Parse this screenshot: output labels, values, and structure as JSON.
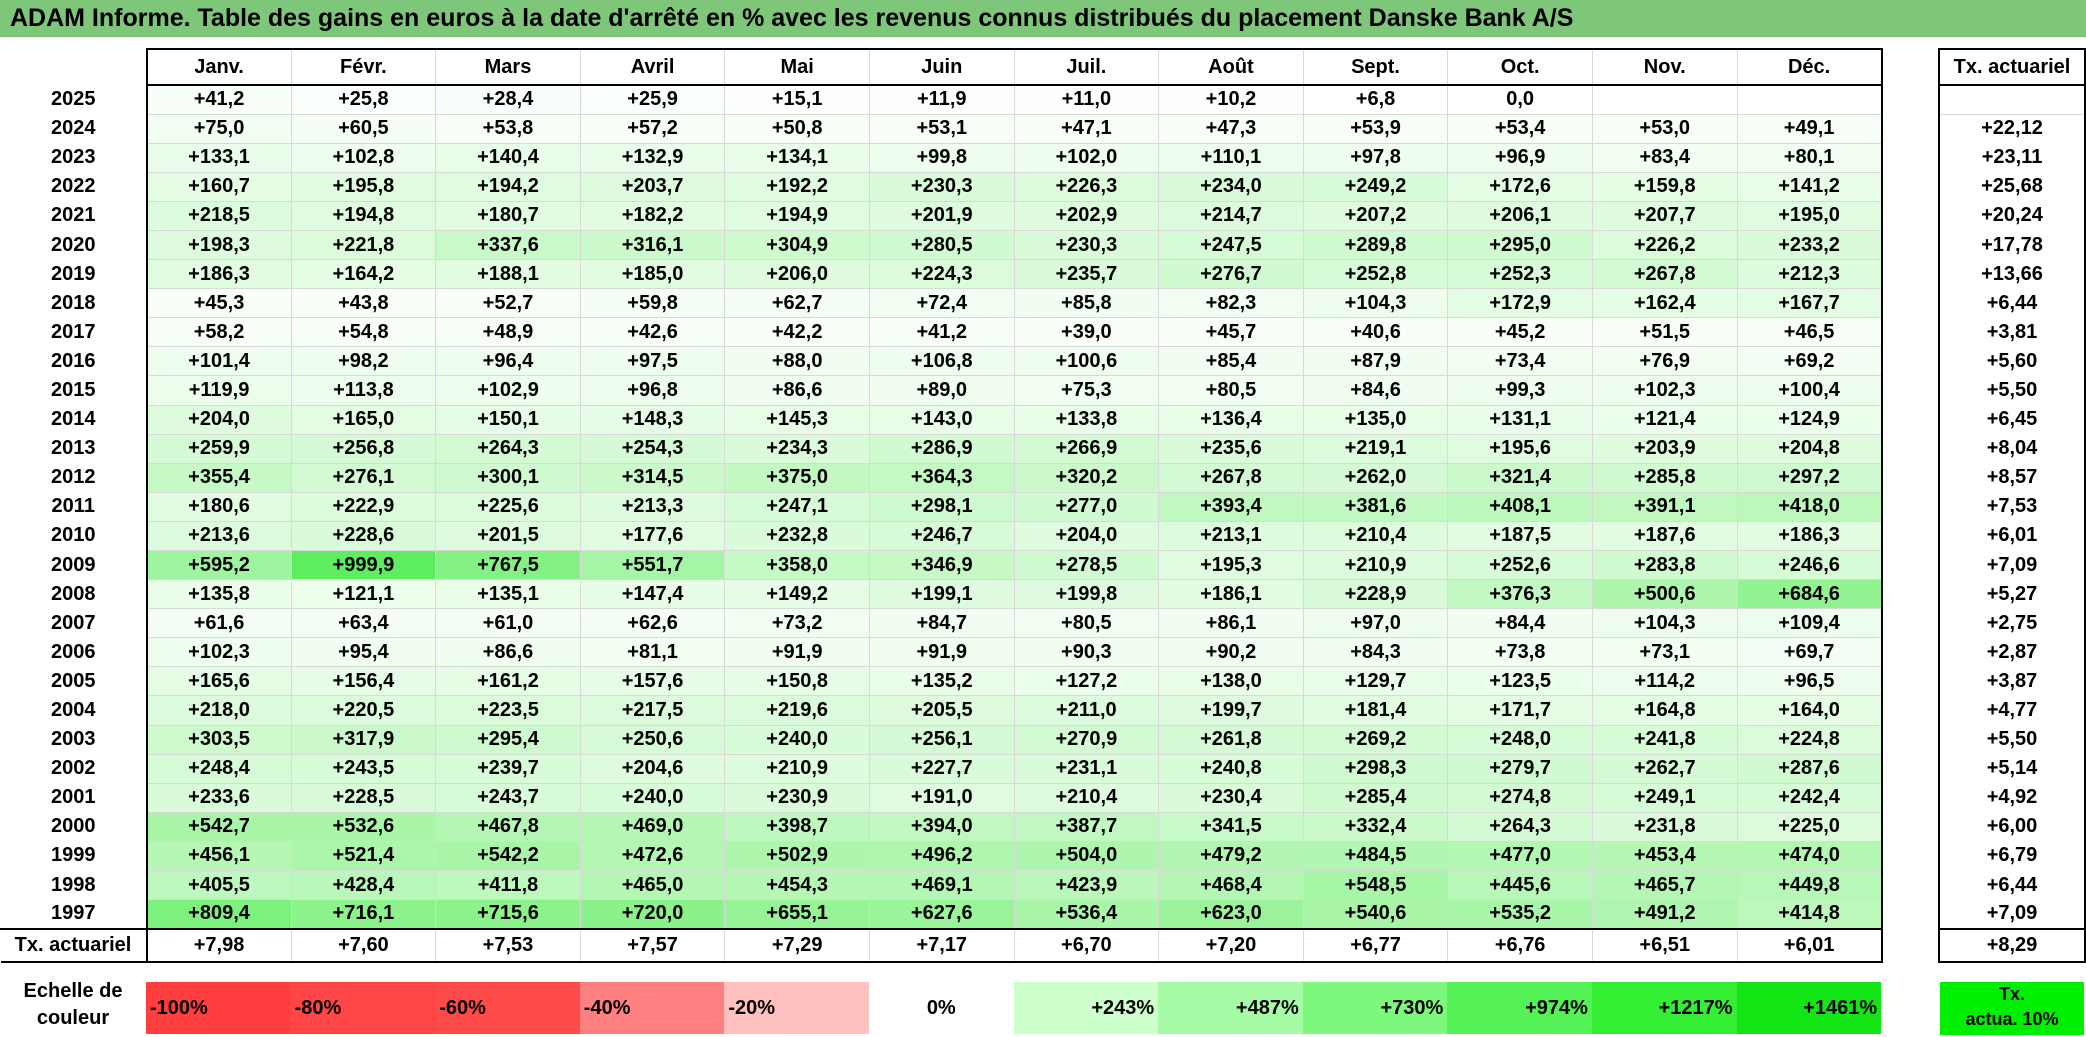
{
  "title": "ADAM Informe. Table des gains en euros à la date d'arrêté en % avec les revenus connus distribués du placement Danske Bank A/S",
  "months": [
    "Janv.",
    "Févr.",
    "Mars",
    "Avril",
    "Mai",
    "Juin",
    "Juil.",
    "Août",
    "Sept.",
    "Oct.",
    "Nov.",
    "Déc."
  ],
  "tx_header": "Tx. actuariel",
  "rows": [
    {
      "year": "2025",
      "values": [
        "+41,2",
        "+25,8",
        "+28,4",
        "+25,9",
        "+15,1",
        "+11,9",
        "+11,0",
        "+10,2",
        "+6,8",
        "0,0",
        "",
        ""
      ],
      "tx": ""
    },
    {
      "year": "2024",
      "values": [
        "+75,0",
        "+60,5",
        "+53,8",
        "+57,2",
        "+50,8",
        "+53,1",
        "+47,1",
        "+47,3",
        "+53,9",
        "+53,4",
        "+53,0",
        "+49,1"
      ],
      "tx": "+22,12"
    },
    {
      "year": "2023",
      "values": [
        "+133,1",
        "+102,8",
        "+140,4",
        "+132,9",
        "+134,1",
        "+99,8",
        "+102,0",
        "+110,1",
        "+97,8",
        "+96,9",
        "+83,4",
        "+80,1"
      ],
      "tx": "+23,11"
    },
    {
      "year": "2022",
      "values": [
        "+160,7",
        "+195,8",
        "+194,2",
        "+203,7",
        "+192,2",
        "+230,3",
        "+226,3",
        "+234,0",
        "+249,2",
        "+172,6",
        "+159,8",
        "+141,2"
      ],
      "tx": "+25,68"
    },
    {
      "year": "2021",
      "values": [
        "+218,5",
        "+194,8",
        "+180,7",
        "+182,2",
        "+194,9",
        "+201,9",
        "+202,9",
        "+214,7",
        "+207,2",
        "+206,1",
        "+207,7",
        "+195,0"
      ],
      "tx": "+20,24"
    },
    {
      "year": "2020",
      "values": [
        "+198,3",
        "+221,8",
        "+337,6",
        "+316,1",
        "+304,9",
        "+280,5",
        "+230,3",
        "+247,5",
        "+289,8",
        "+295,0",
        "+226,2",
        "+233,2"
      ],
      "tx": "+17,78"
    },
    {
      "year": "2019",
      "values": [
        "+186,3",
        "+164,2",
        "+188,1",
        "+185,0",
        "+206,0",
        "+224,3",
        "+235,7",
        "+276,7",
        "+252,8",
        "+252,3",
        "+267,8",
        "+212,3"
      ],
      "tx": "+13,66"
    },
    {
      "year": "2018",
      "values": [
        "+45,3",
        "+43,8",
        "+52,7",
        "+59,8",
        "+62,7",
        "+72,4",
        "+85,8",
        "+82,3",
        "+104,3",
        "+172,9",
        "+162,4",
        "+167,7"
      ],
      "tx": "+6,44"
    },
    {
      "year": "2017",
      "values": [
        "+58,2",
        "+54,8",
        "+48,9",
        "+42,6",
        "+42,2",
        "+41,2",
        "+39,0",
        "+45,7",
        "+40,6",
        "+45,2",
        "+51,5",
        "+46,5"
      ],
      "tx": "+3,81"
    },
    {
      "year": "2016",
      "values": [
        "+101,4",
        "+98,2",
        "+96,4",
        "+97,5",
        "+88,0",
        "+106,8",
        "+100,6",
        "+85,4",
        "+87,9",
        "+73,4",
        "+76,9",
        "+69,2"
      ],
      "tx": "+5,60"
    },
    {
      "year": "2015",
      "values": [
        "+119,9",
        "+113,8",
        "+102,9",
        "+96,8",
        "+86,6",
        "+89,0",
        "+75,3",
        "+80,5",
        "+84,6",
        "+99,3",
        "+102,3",
        "+100,4"
      ],
      "tx": "+5,50"
    },
    {
      "year": "2014",
      "values": [
        "+204,0",
        "+165,0",
        "+150,1",
        "+148,3",
        "+145,3",
        "+143,0",
        "+133,8",
        "+136,4",
        "+135,0",
        "+131,1",
        "+121,4",
        "+124,9"
      ],
      "tx": "+6,45"
    },
    {
      "year": "2013",
      "values": [
        "+259,9",
        "+256,8",
        "+264,3",
        "+254,3",
        "+234,3",
        "+286,9",
        "+266,9",
        "+235,6",
        "+219,1",
        "+195,6",
        "+203,9",
        "+204,8"
      ],
      "tx": "+8,04"
    },
    {
      "year": "2012",
      "values": [
        "+355,4",
        "+276,1",
        "+300,1",
        "+314,5",
        "+375,0",
        "+364,3",
        "+320,2",
        "+267,8",
        "+262,0",
        "+321,4",
        "+285,8",
        "+297,2"
      ],
      "tx": "+8,57"
    },
    {
      "year": "2011",
      "values": [
        "+180,6",
        "+222,9",
        "+225,6",
        "+213,3",
        "+247,1",
        "+298,1",
        "+277,0",
        "+393,4",
        "+381,6",
        "+408,1",
        "+391,1",
        "+418,0"
      ],
      "tx": "+7,53"
    },
    {
      "year": "2010",
      "values": [
        "+213,6",
        "+228,6",
        "+201,5",
        "+177,6",
        "+232,8",
        "+246,7",
        "+204,0",
        "+213,1",
        "+210,4",
        "+187,5",
        "+187,6",
        "+186,3"
      ],
      "tx": "+6,01"
    },
    {
      "year": "2009",
      "values": [
        "+595,2",
        "+999,9",
        "+767,5",
        "+551,7",
        "+358,0",
        "+346,9",
        "+278,5",
        "+195,3",
        "+210,9",
        "+252,6",
        "+283,8",
        "+246,6"
      ],
      "tx": "+7,09"
    },
    {
      "year": "2008",
      "values": [
        "+135,8",
        "+121,1",
        "+135,1",
        "+147,4",
        "+149,2",
        "+199,1",
        "+199,8",
        "+186,1",
        "+228,9",
        "+376,3",
        "+500,6",
        "+684,6"
      ],
      "tx": "+5,27"
    },
    {
      "year": "2007",
      "values": [
        "+61,6",
        "+63,4",
        "+61,0",
        "+62,6",
        "+73,2",
        "+84,7",
        "+80,5",
        "+86,1",
        "+97,0",
        "+84,4",
        "+104,3",
        "+109,4"
      ],
      "tx": "+2,75"
    },
    {
      "year": "2006",
      "values": [
        "+102,3",
        "+95,4",
        "+86,6",
        "+81,1",
        "+91,9",
        "+91,9",
        "+90,3",
        "+90,2",
        "+84,3",
        "+73,8",
        "+73,1",
        "+69,7"
      ],
      "tx": "+2,87"
    },
    {
      "year": "2005",
      "values": [
        "+165,6",
        "+156,4",
        "+161,2",
        "+157,6",
        "+150,8",
        "+135,2",
        "+127,2",
        "+138,0",
        "+129,7",
        "+123,5",
        "+114,2",
        "+96,5"
      ],
      "tx": "+3,87"
    },
    {
      "year": "2004",
      "values": [
        "+218,0",
        "+220,5",
        "+223,5",
        "+217,5",
        "+219,6",
        "+205,5",
        "+211,0",
        "+199,7",
        "+181,4",
        "+171,7",
        "+164,8",
        "+164,0"
      ],
      "tx": "+4,77"
    },
    {
      "year": "2003",
      "values": [
        "+303,5",
        "+317,9",
        "+295,4",
        "+250,6",
        "+240,0",
        "+256,1",
        "+270,9",
        "+261,8",
        "+269,2",
        "+248,0",
        "+241,8",
        "+224,8"
      ],
      "tx": "+5,50"
    },
    {
      "year": "2002",
      "values": [
        "+248,4",
        "+243,5",
        "+239,7",
        "+204,6",
        "+210,9",
        "+227,7",
        "+231,1",
        "+240,8",
        "+298,3",
        "+279,7",
        "+262,7",
        "+287,6"
      ],
      "tx": "+5,14"
    },
    {
      "year": "2001",
      "values": [
        "+233,6",
        "+228,5",
        "+243,7",
        "+240,0",
        "+230,9",
        "+191,0",
        "+210,4",
        "+230,4",
        "+285,4",
        "+274,8",
        "+249,1",
        "+242,4"
      ],
      "tx": "+4,92"
    },
    {
      "year": "2000",
      "values": [
        "+542,7",
        "+532,6",
        "+467,8",
        "+469,0",
        "+398,7",
        "+394,0",
        "+387,7",
        "+341,5",
        "+332,4",
        "+264,3",
        "+231,8",
        "+225,0"
      ],
      "tx": "+6,00"
    },
    {
      "year": "1999",
      "values": [
        "+456,1",
        "+521,4",
        "+542,2",
        "+472,6",
        "+502,9",
        "+496,2",
        "+504,0",
        "+479,2",
        "+484,5",
        "+477,0",
        "+453,4",
        "+474,0"
      ],
      "tx": "+6,79"
    },
    {
      "year": "1998",
      "values": [
        "+405,5",
        "+428,4",
        "+411,8",
        "+465,0",
        "+454,3",
        "+469,1",
        "+423,9",
        "+468,4",
        "+548,5",
        "+445,6",
        "+465,7",
        "+449,8"
      ],
      "tx": "+6,44"
    },
    {
      "year": "1997",
      "values": [
        "+809,4",
        "+716,1",
        "+715,6",
        "+720,0",
        "+655,1",
        "+627,6",
        "+536,4",
        "+623,0",
        "+540,6",
        "+535,2",
        "+491,2",
        "+414,8"
      ],
      "tx": "+7,09"
    }
  ],
  "footer": {
    "label": "Tx. actuariel",
    "values": [
      "+7,98",
      "+7,60",
      "+7,53",
      "+7,57",
      "+7,29",
      "+7,17",
      "+6,70",
      "+7,20",
      "+6,77",
      "+6,76",
      "+6,51",
      "+6,01"
    ],
    "overall": "+8,29"
  },
  "scale": {
    "label_line1": "Echelle de",
    "label_line2": "couleur",
    "items": [
      {
        "label": "-100%",
        "color": "#ff3f3f"
      },
      {
        "label": "-80%",
        "color": "#ff4545"
      },
      {
        "label": "-60%",
        "color": "#ff4a4a"
      },
      {
        "label": "-40%",
        "color": "#ff8080"
      },
      {
        "label": "-20%",
        "color": "#ffc0c0"
      },
      {
        "label": "0%",
        "color": "#ffffff"
      },
      {
        "label": "+243%",
        "color": "#ccffcc"
      },
      {
        "label": "+487%",
        "color": "#a6fca6"
      },
      {
        "label": "+730%",
        "color": "#7cf97c"
      },
      {
        "label": "+974%",
        "color": "#55f255"
      },
      {
        "label": "+1217%",
        "color": "#33ee33"
      },
      {
        "label": "+1461%",
        "color": "#14e514"
      }
    ],
    "actua_line1": "Tx.",
    "actua_line2": "actua. 10%",
    "actua_color": "#00ee00"
  }
}
